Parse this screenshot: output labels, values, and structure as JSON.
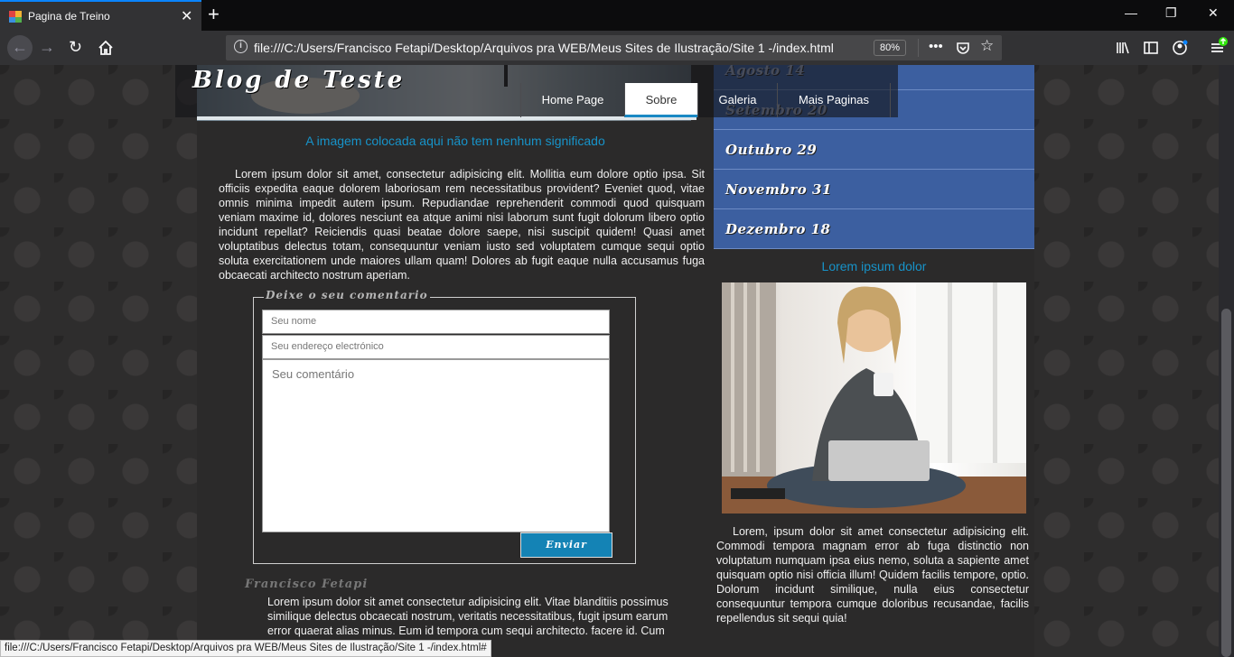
{
  "browser": {
    "tab_title": "Pagina de Treino",
    "url": "file:///C:/Users/Francisco Fetapi/Desktop/Arquivos pra WEB/Meus Sites de Ilustração/Site 1 -/index.html",
    "zoom": "80%",
    "status_url": "file:///C:/Users/Francisco Fetapi/Desktop/Arquivos pra WEB/Meus Sites de Ilustração/Site 1 -/index.html#"
  },
  "site": {
    "logo": "Blog de Teste",
    "menu": [
      "Home Page",
      "Sobre",
      "Galeria",
      "Mais Paginas"
    ],
    "active_menu": "Sobre",
    "header_caption": "A imagem colocada aqui não tem nenhum significado",
    "intro": "Lorem ipsum dolor sit amet, consectetur adipisicing elit. Mollitia eum dolore optio ipsa. Sit officiis expedita eaque dolorem laboriosam rem necessitatibus provident? Eveniet quod, vitae omnis minima impedit autem ipsum. Repudiandae reprehenderit commodi quod quisquam veniam maxime id, dolores nesciunt ea atque animi nisi laborum sunt fugit dolorum libero optio incidunt repellat? Reiciendis quasi beatae dolore saepe, nisi suscipit quidem! Quasi amet voluptatibus delectus totam, consequuntur veniam iusto sed voluptatem cumque sequi optio soluta exercitationem unde maiores ullam quam! Dolores ab fugit eaque nulla accusamus fuga obcaecati architecto nostrum aperiam."
  },
  "comment_form": {
    "legend": "Deixe o seu comentario",
    "name_placeholder": "Seu nome",
    "email_placeholder": "Seu endereço electrónico",
    "comment_placeholder": "Seu comentário",
    "submit": "Enviar"
  },
  "comment": {
    "author": "Francisco Fetapi",
    "text": "Lorem ipsum dolor sit amet consectetur adipisicing elit. Vitae blanditiis possimus similique delectus obcaecati nostrum, veritatis necessitatibus, fugit ipsum earum error quaerat alias minus. Eum id tempora cum sequi architecto. facere id. Cum"
  },
  "sidebar": {
    "months": [
      "Agosto 14",
      "Setembro 20",
      "Outubro 29",
      "Novembro 31",
      "Dezembro 18"
    ],
    "caption": "Lorem ipsum dolor",
    "text": "Lorem, ipsum dolor sit amet consectetur adipisicing elit. Commodi tempora magnam error ab fuga distinctio non voluptatum numquam ipsa eius nemo, soluta a sapiente amet quisquam optio nisi officia illum! Quidem facilis tempore, optio. Dolorum incidunt similique, nulla eius consectetur consequuntur tempora cumque doloribus recusandae, facilis repellendus sit sequi quia!"
  },
  "colors": {
    "accent": "#1793c9",
    "sidebar": "#3c5fa0",
    "tab_highlight": "#0a84ff"
  }
}
